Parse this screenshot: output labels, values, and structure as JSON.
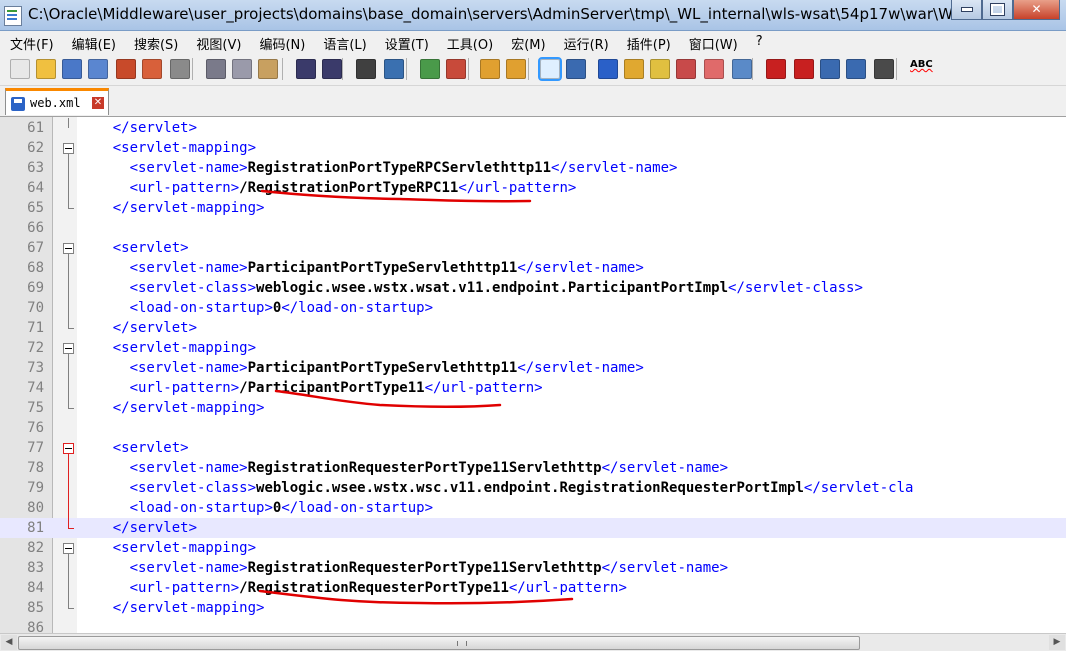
{
  "window": {
    "title": "C:\\Oracle\\Middleware\\user_projects\\domains\\base_domain\\servers\\AdminServer\\tmp\\_WL_internal\\wls-wsat\\54p17w\\war\\WEB-..."
  },
  "menu": [
    "文件(F)",
    "编辑(E)",
    "搜索(S)",
    "视图(V)",
    "编码(N)",
    "语言(L)",
    "设置(T)",
    "工具(O)",
    "宏(M)",
    "运行(R)",
    "插件(P)",
    "窗口(W)",
    "?"
  ],
  "tab": {
    "label": "web.xml"
  },
  "editor": {
    "lines": [
      {
        "num": "61",
        "indent": "    ",
        "segments": [
          {
            "t": "tag",
            "s": "</servlet>"
          }
        ]
      },
      {
        "num": "62",
        "indent": "    ",
        "segments": [
          {
            "t": "tag",
            "s": "<servlet-mapping>"
          }
        ]
      },
      {
        "num": "63",
        "indent": "      ",
        "segments": [
          {
            "t": "tag",
            "s": "<servlet-name>"
          },
          {
            "t": "val",
            "s": "RegistrationPortTypeRPCServlethttp11"
          },
          {
            "t": "tag",
            "s": "</servlet-name>"
          }
        ]
      },
      {
        "num": "64",
        "indent": "      ",
        "segments": [
          {
            "t": "tag",
            "s": "<url-pattern>"
          },
          {
            "t": "val",
            "s": "/RegistrationPortTypeRPC11"
          },
          {
            "t": "tag",
            "s": "</url-pattern>"
          }
        ]
      },
      {
        "num": "65",
        "indent": "    ",
        "segments": [
          {
            "t": "tag",
            "s": "</servlet-mapping>"
          }
        ]
      },
      {
        "num": "66",
        "indent": "",
        "segments": []
      },
      {
        "num": "67",
        "indent": "    ",
        "segments": [
          {
            "t": "tag",
            "s": "<servlet>"
          }
        ]
      },
      {
        "num": "68",
        "indent": "      ",
        "segments": [
          {
            "t": "tag",
            "s": "<servlet-name>"
          },
          {
            "t": "val",
            "s": "ParticipantPortTypeServlethttp11"
          },
          {
            "t": "tag",
            "s": "</servlet-name>"
          }
        ]
      },
      {
        "num": "69",
        "indent": "      ",
        "segments": [
          {
            "t": "tag",
            "s": "<servlet-class>"
          },
          {
            "t": "val",
            "s": "weblogic.wsee.wstx.wsat.v11.endpoint.ParticipantPortImpl"
          },
          {
            "t": "tag",
            "s": "</servlet-class>"
          }
        ]
      },
      {
        "num": "70",
        "indent": "      ",
        "segments": [
          {
            "t": "tag",
            "s": "<load-on-startup>"
          },
          {
            "t": "val",
            "s": "0"
          },
          {
            "t": "tag",
            "s": "</load-on-startup>"
          }
        ]
      },
      {
        "num": "71",
        "indent": "    ",
        "segments": [
          {
            "t": "tag",
            "s": "</servlet>"
          }
        ]
      },
      {
        "num": "72",
        "indent": "    ",
        "segments": [
          {
            "t": "tag",
            "s": "<servlet-mapping>"
          }
        ]
      },
      {
        "num": "73",
        "indent": "      ",
        "segments": [
          {
            "t": "tag",
            "s": "<servlet-name>"
          },
          {
            "t": "val",
            "s": "ParticipantPortTypeServlethttp11"
          },
          {
            "t": "tag",
            "s": "</servlet-name>"
          }
        ]
      },
      {
        "num": "74",
        "indent": "      ",
        "segments": [
          {
            "t": "tag",
            "s": "<url-pattern>"
          },
          {
            "t": "val",
            "s": "/ParticipantPortType11"
          },
          {
            "t": "tag",
            "s": "</url-pattern>"
          }
        ]
      },
      {
        "num": "75",
        "indent": "    ",
        "segments": [
          {
            "t": "tag",
            "s": "</servlet-mapping>"
          }
        ]
      },
      {
        "num": "76",
        "indent": "",
        "segments": []
      },
      {
        "num": "77",
        "indent": "    ",
        "segments": [
          {
            "t": "tag",
            "s": "<servlet>"
          }
        ]
      },
      {
        "num": "78",
        "indent": "      ",
        "segments": [
          {
            "t": "tag",
            "s": "<servlet-name>"
          },
          {
            "t": "val",
            "s": "RegistrationRequesterPortType11Servlethttp"
          },
          {
            "t": "tag",
            "s": "</servlet-name>"
          }
        ]
      },
      {
        "num": "79",
        "indent": "      ",
        "segments": [
          {
            "t": "tag",
            "s": "<servlet-class>"
          },
          {
            "t": "val",
            "s": "weblogic.wsee.wstx.wsc.v11.endpoint.RegistrationRequesterPortImpl"
          },
          {
            "t": "tag",
            "s": "</servlet-cla"
          }
        ]
      },
      {
        "num": "80",
        "indent": "      ",
        "segments": [
          {
            "t": "tag",
            "s": "<load-on-startup>"
          },
          {
            "t": "val",
            "s": "0"
          },
          {
            "t": "tag",
            "s": "</load-on-startup>"
          }
        ]
      },
      {
        "num": "81",
        "indent": "    ",
        "segments": [
          {
            "t": "tag",
            "s": "</servlet>"
          }
        ]
      },
      {
        "num": "82",
        "indent": "    ",
        "segments": [
          {
            "t": "tag",
            "s": "<servlet-mapping>"
          }
        ]
      },
      {
        "num": "83",
        "indent": "      ",
        "segments": [
          {
            "t": "tag",
            "s": "<servlet-name>"
          },
          {
            "t": "val",
            "s": "RegistrationRequesterPortType11Servlethttp"
          },
          {
            "t": "tag",
            "s": "</servlet-name>"
          }
        ]
      },
      {
        "num": "84",
        "indent": "      ",
        "segments": [
          {
            "t": "tag",
            "s": "<url-pattern>"
          },
          {
            "t": "val",
            "s": "/RegistrationRequesterPortType11"
          },
          {
            "t": "tag",
            "s": "</url-pattern>"
          }
        ]
      },
      {
        "num": "85",
        "indent": "    ",
        "segments": [
          {
            "t": "tag",
            "s": "</servlet-mapping>"
          }
        ]
      },
      {
        "num": "86",
        "indent": "",
        "segments": []
      }
    ],
    "current_line": "81",
    "annotation_color": "#e00000"
  },
  "toolbar_icons": [
    "new-file-icon",
    "open-file-icon",
    "save-icon",
    "save-all-icon",
    "close-icon",
    "close-all-icon",
    "print-icon",
    "cut-icon",
    "copy-icon",
    "paste-icon",
    "undo-icon",
    "redo-icon",
    "find-icon",
    "replace-icon",
    "zoom-in-icon",
    "zoom-out-icon",
    "sync-vertical-icon",
    "sync-horizontal-icon",
    "word-wrap-icon",
    "show-all-chars-icon",
    "indent-guide-icon",
    "lang-udl-icon",
    "doc-map-icon",
    "function-list-icon",
    "folder-workspace-icon",
    "monitor-icon",
    "record-macro-icon",
    "stop-record-icon",
    "play-macro-icon",
    "run-macro-multiple-icon",
    "save-macro-icon",
    "spell-check-icon"
  ]
}
